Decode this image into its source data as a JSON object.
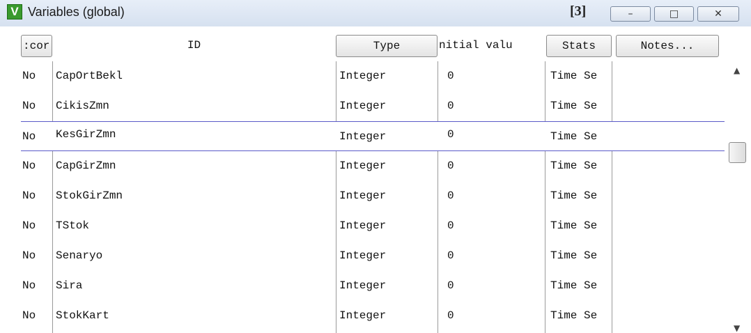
{
  "window": {
    "title": "Variables (global)",
    "app_icon_letter": "V",
    "count": "[3]",
    "minimize_glyph": "–",
    "maximize_glyph": "□",
    "close_glyph": "✕"
  },
  "columns": {
    "icon": ":cor",
    "id": "ID",
    "type": "Type",
    "initial_value": "nitial valu",
    "stats": "Stats",
    "notes": "Notes..."
  },
  "rows": [
    {
      "on": "No",
      "id": "CapOrtBekl",
      "type": "Integer",
      "init": "0",
      "stats": "Time Se"
    },
    {
      "on": "No",
      "id": "CikisZmn",
      "type": "Integer",
      "init": "0",
      "stats": "Time Se"
    },
    {
      "on": "No",
      "id": "KesGirZmn",
      "type": "Integer",
      "init": "0",
      "stats": "Time Se"
    },
    {
      "on": "No",
      "id": "CapGirZmn",
      "type": "Integer",
      "init": "0",
      "stats": "Time Se"
    },
    {
      "on": "No",
      "id": "StokGirZmn",
      "type": "Integer",
      "init": "0",
      "stats": "Time Se"
    },
    {
      "on": "No",
      "id": "TStok",
      "type": "Integer",
      "init": "0",
      "stats": "Time Se"
    },
    {
      "on": "No",
      "id": "Senaryo",
      "type": "Integer",
      "init": "0",
      "stats": "Time Se"
    },
    {
      "on": "No",
      "id": "Sira",
      "type": "Integer",
      "init": "0",
      "stats": "Time Se"
    },
    {
      "on": "No",
      "id": "StokKart",
      "type": "Integer",
      "init": "0",
      "stats": "Time Se"
    }
  ],
  "selected_row": 2,
  "scrollbar": {
    "up_glyph": "▲",
    "down_glyph": "▼"
  }
}
